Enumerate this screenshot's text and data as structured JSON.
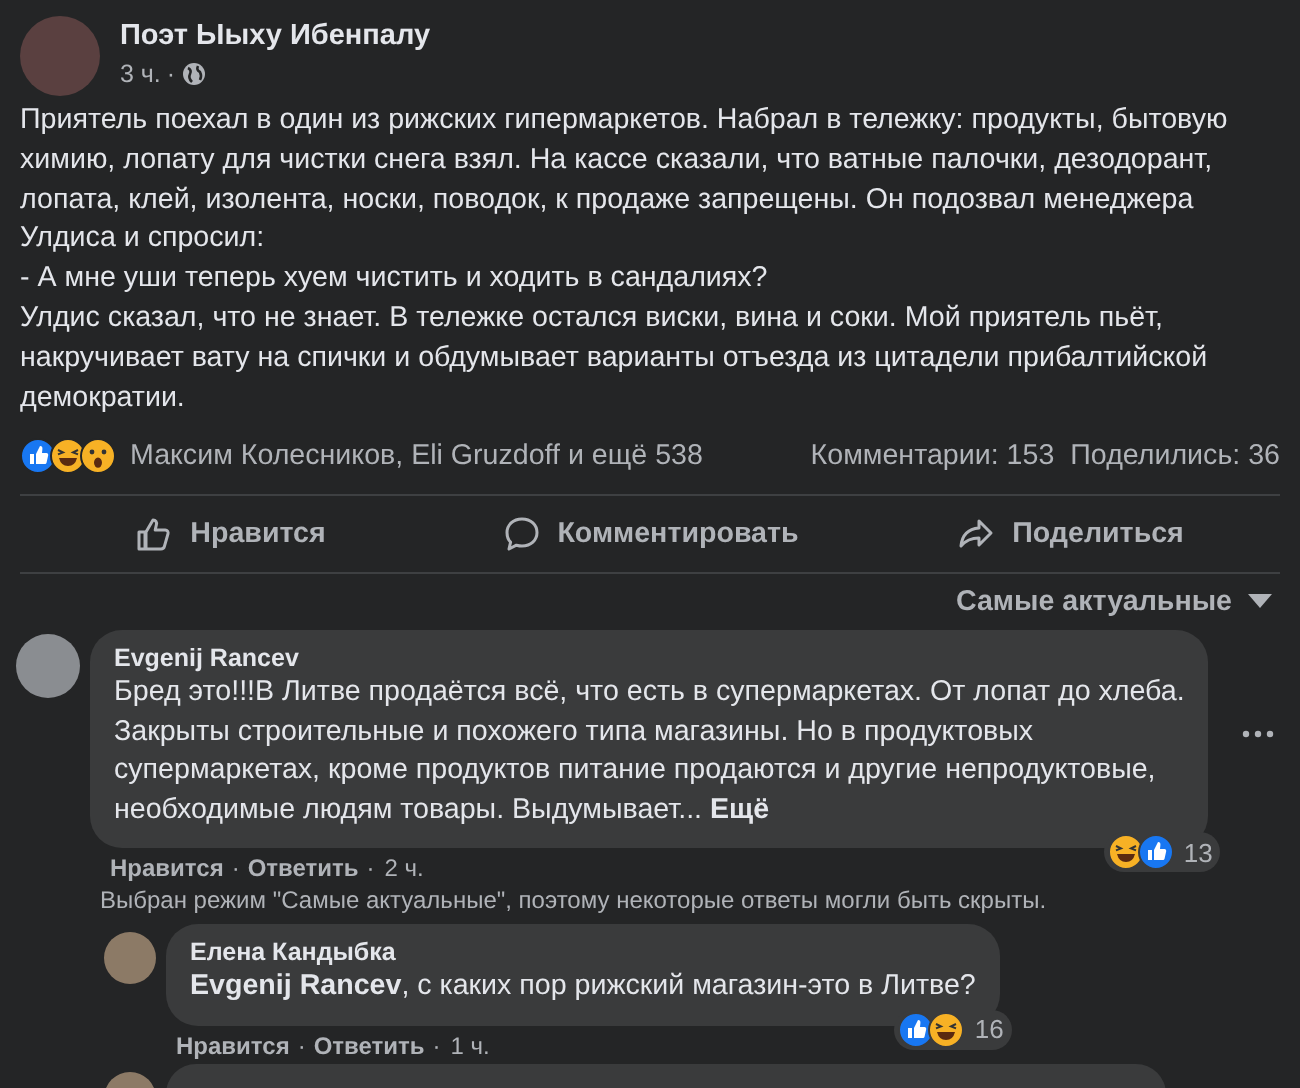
{
  "post": {
    "author": "Поэт Ыыху Ибенпалу",
    "time": "3 ч.",
    "separator": "·",
    "body": "Приятель поехал в один из рижских гипермаркетов. Набрал в тележку: продукты, бытовую\nхимию, лопату для чистки снега взял. На кассе сказали, что ватные палочки, дезодорант,\nлопата, клей, изолента, носки, поводок, к продаже запрещены. Он подозвал менеджера\nУлдиса и спросил:\n- А мне уши теперь хуем чистить и ходить в сандалиях?\nУлдис сказал, что не знает. В тележке остался виски, вина и соки. Мой приятель пьёт,\nнакручивает вату на спички и обдумывает варианты отъезда из цитадели прибалтийской\nдемократии.",
    "reaction_icons": [
      {
        "kind": "like"
      },
      {
        "kind": "haha"
      },
      {
        "kind": "wow"
      }
    ],
    "reacted_by": "Максим Колесников, Eli Gruzdoff и ещё 538",
    "comments_count": "Комментарии: 153",
    "shares_count": "Поделились: 36",
    "actions": [
      {
        "kind": "like",
        "label": "Нравится"
      },
      {
        "kind": "comment",
        "label": "Комментировать"
      },
      {
        "kind": "share",
        "label": "Поделиться"
      }
    ]
  },
  "sort": {
    "label": "Самые актуальные"
  },
  "comments": [
    {
      "author": "Evgenij Rancev",
      "text": "Бред это!!!В Литве продаётся всё, что есть в супермаркетах. От лопат до хлеба.\nЗакрыты строительные и похожего типа магазины. Но в продуктовых\nсупермаркетах, кроме продуктов питание продаются и другие непродуктовые,\nнеобходимые людям товары. Выдумывает...",
      "more": "Ещё",
      "reaction_icons": [
        {
          "kind": "haha"
        },
        {
          "kind": "like"
        }
      ],
      "reaction_count": "13",
      "meta": [
        {
          "kind": "link",
          "text": "Нравится"
        },
        {
          "kind": "sep",
          "text": "·"
        },
        {
          "kind": "link",
          "text": "Ответить"
        },
        {
          "kind": "sep",
          "text": "·"
        },
        {
          "kind": "time",
          "text": "2 ч."
        }
      ],
      "note": "Выбран режим \"Самые актуальные\", поэтому некоторые ответы могли быть скрыты.",
      "children": [
        {
          "author": "Елена Кандыбка",
          "mention": "Evgenij Rancev",
          "text": ", с каких пор рижский магазин-это в Литве?",
          "reaction_icons": [
            {
              "kind": "like"
            },
            {
              "kind": "haha"
            }
          ],
          "reaction_count": "16",
          "meta": [
            {
              "kind": "link",
              "text": "Нравится"
            },
            {
              "kind": "sep",
              "text": "·"
            },
            {
              "kind": "link",
              "text": "Ответить"
            },
            {
              "kind": "sep",
              "text": "·"
            },
            {
              "kind": "time",
              "text": "1 ч."
            }
          ]
        }
      ]
    }
  ]
}
